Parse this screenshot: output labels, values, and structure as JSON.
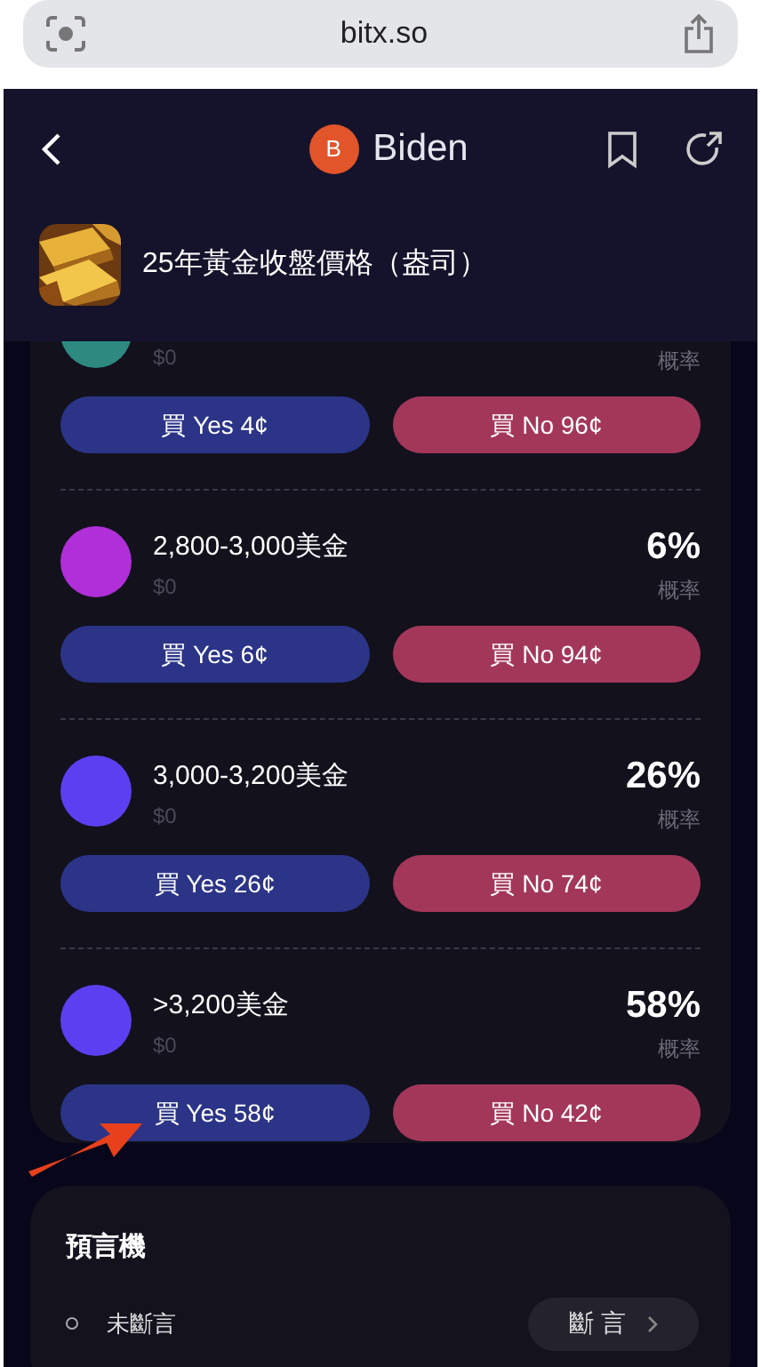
{
  "browser": {
    "url": "bitx.so"
  },
  "header": {
    "avatar_letter": "B",
    "name": "Biden"
  },
  "event": {
    "title": "25年黃金收盤價格（盎司）"
  },
  "markets": [
    {
      "amount": "$0",
      "prob_label": "概率",
      "color": "#2e8a80",
      "yes": "買 Yes 4¢",
      "no": "買 No 96¢"
    },
    {
      "name": "2,800-3,000美金",
      "percent": "6%",
      "amount": "$0",
      "prob_label": "概率",
      "color": "#b02fd8",
      "yes": "買 Yes 6¢",
      "no": "買 No 94¢"
    },
    {
      "name": "3,000-3,200美金",
      "percent": "26%",
      "amount": "$0",
      "prob_label": "概率",
      "color": "#5b3ff0",
      "yes": "買 Yes 26¢",
      "no": "買 No 74¢"
    },
    {
      "name": ">3,200美金",
      "percent": "58%",
      "amount": "$0",
      "prob_label": "概率",
      "color": "#5b3ff0",
      "yes": "買 Yes 58¢",
      "no": "買 No 42¢"
    }
  ],
  "oracle": {
    "title": "預言機",
    "status": "未斷言",
    "button": "斷 言"
  }
}
